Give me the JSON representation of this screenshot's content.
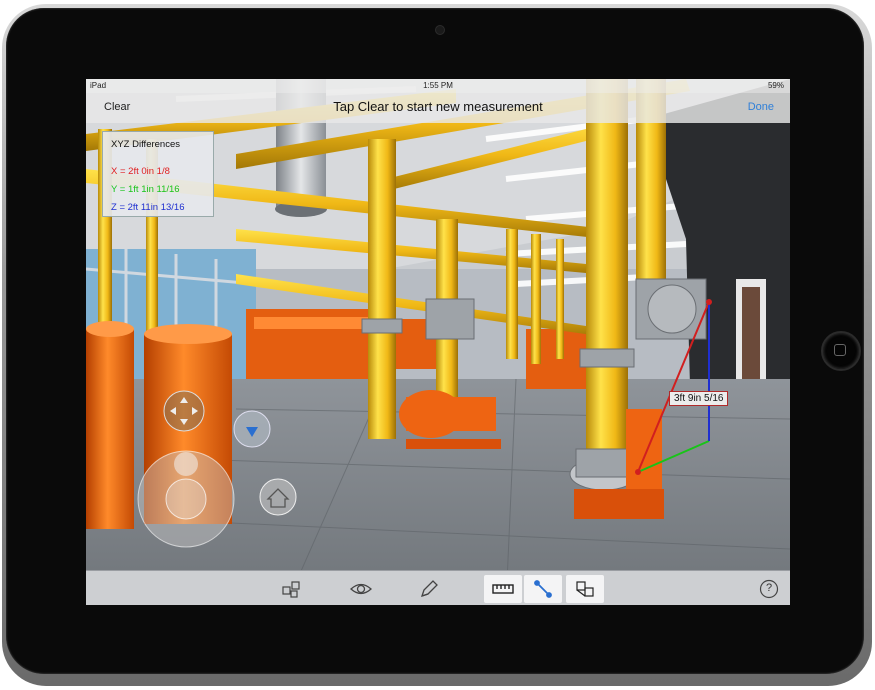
{
  "status_bar": {
    "carrier": "iPad",
    "time": "1:55 PM",
    "battery": "59%"
  },
  "nav": {
    "left_button": "Clear",
    "title": "Tap Clear to start new measurement",
    "right_button": "Done"
  },
  "xyz_panel": {
    "heading": "XYZ Differences",
    "x": "X = 2ft 0in 1/8",
    "y": "Y = 1ft 1in 11/16",
    "z": "Z = 2ft 11in 13/16"
  },
  "measurement_label": "3ft 9in 5/16",
  "toolbar": {
    "items": [
      {
        "icon": "cubes-icon",
        "selected": false
      },
      {
        "icon": "eye-icon",
        "selected": false
      },
      {
        "icon": "pencil-icon",
        "selected": false
      },
      {
        "icon": "ruler-icon",
        "selected": true
      },
      {
        "icon": "point-measure-icon",
        "selected": true
      },
      {
        "icon": "box-section-icon",
        "selected": true
      },
      {
        "icon": "help-icon",
        "selected": false
      }
    ],
    "help_label": "?"
  },
  "colors": {
    "pipe_yellow": "#f2c01a",
    "equipment_orange": "#ee6412",
    "measure_red": "#d11f1f"
  }
}
